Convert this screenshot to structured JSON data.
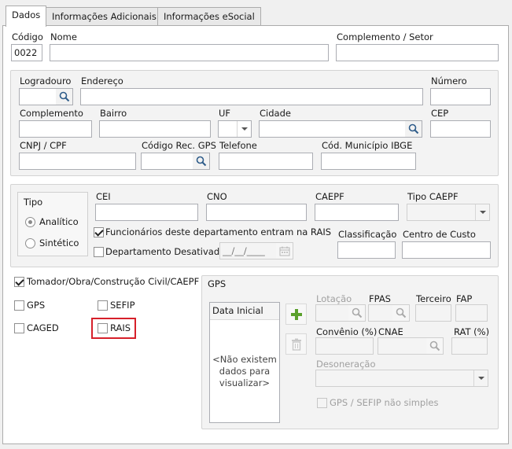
{
  "tabs": [
    {
      "label": "Dados",
      "active": true
    },
    {
      "label": "Informações Adicionais",
      "active": false
    },
    {
      "label": "Informações eSocial",
      "active": false
    }
  ],
  "top": {
    "codigo_label": "Código",
    "codigo_value": "0022",
    "nome_label": "Nome",
    "nome_value": "",
    "complemento_setor_label": "Complemento / Setor",
    "complemento_setor_value": ""
  },
  "address": {
    "logradouro_label": "Logradouro",
    "endereco_label": "Endereço",
    "numero_label": "Número",
    "complemento_label": "Complemento",
    "bairro_label": "Bairro",
    "uf_label": "UF",
    "cidade_label": "Cidade",
    "cep_label": "CEP",
    "cnpj_label": "CNPJ / CPF",
    "codigo_rec_gps_label": "Código Rec. GPS",
    "telefone_label": "Telefone",
    "cod_municipio_label": "Cód. Município IBGE"
  },
  "tipo": {
    "title": "Tipo",
    "analitico": "Analítico",
    "sintetico": "Sintético",
    "selected": "Analítico"
  },
  "mid": {
    "cei_label": "CEI",
    "cno_label": "CNO",
    "caepf_label": "CAEPF",
    "tipo_caepf_label": "Tipo CAEPF",
    "funcionarios_rais": "Funcionários deste departamento entram na RAIS",
    "departamento_desativado": "Departamento Desativado",
    "date_placeholder": "__/__/____",
    "classificacao_label": "Classificação",
    "centro_custo_label": "Centro de Custo"
  },
  "tomador": {
    "label": "Tomador/Obra/Construção Civil/CAEPF",
    "gps": "GPS",
    "sefip": "SEFIP",
    "caged": "CAGED",
    "rais": "RAIS"
  },
  "gps": {
    "title": "GPS",
    "list_header": "Data Inicial",
    "empty_message": "<Não existem dados para visualizar>",
    "lotacao_label": "Lotação",
    "fpas_label": "FPAS",
    "terceiro_label": "Terceiro",
    "fap_label": "FAP",
    "convenio_label": "Convênio (%)",
    "cnae_label": "CNAE",
    "rat_label": "RAT (%)",
    "desoneracao_label": "Desoneração",
    "gps_sefip_label": "GPS / SEFIP não simples"
  },
  "colors": {
    "highlight": "#d6202a",
    "add_icon": "#5aa02c"
  }
}
